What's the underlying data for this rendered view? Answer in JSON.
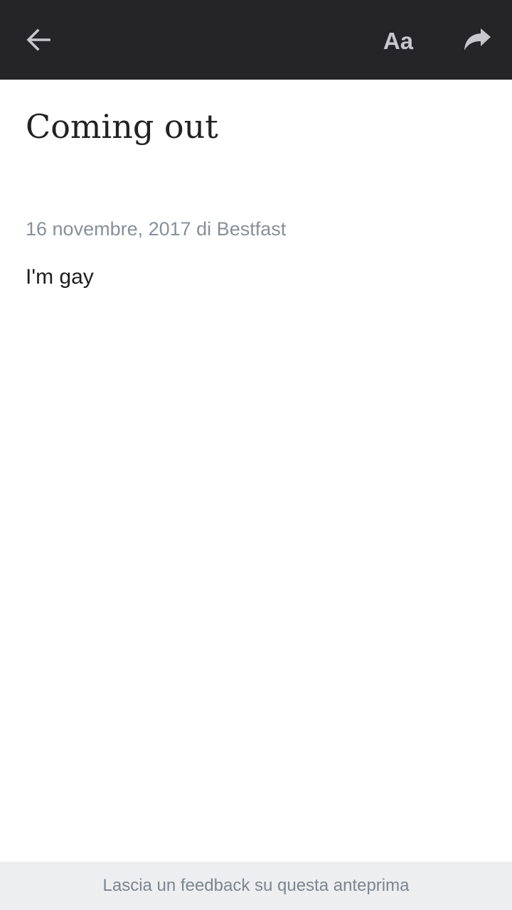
{
  "toolbar": {
    "back_icon": "arrow-left-icon",
    "font_button_label": "Aa",
    "share_icon": "share-arrow-icon",
    "icon_color": "#c8c8cc",
    "background_color": "#252528"
  },
  "article": {
    "title": "Coming out",
    "meta": "16 novembre, 2017 di Bestfast",
    "body": "I'm gay"
  },
  "footer": {
    "feedback_label": "Lascia un feedback su questa anteprima"
  }
}
